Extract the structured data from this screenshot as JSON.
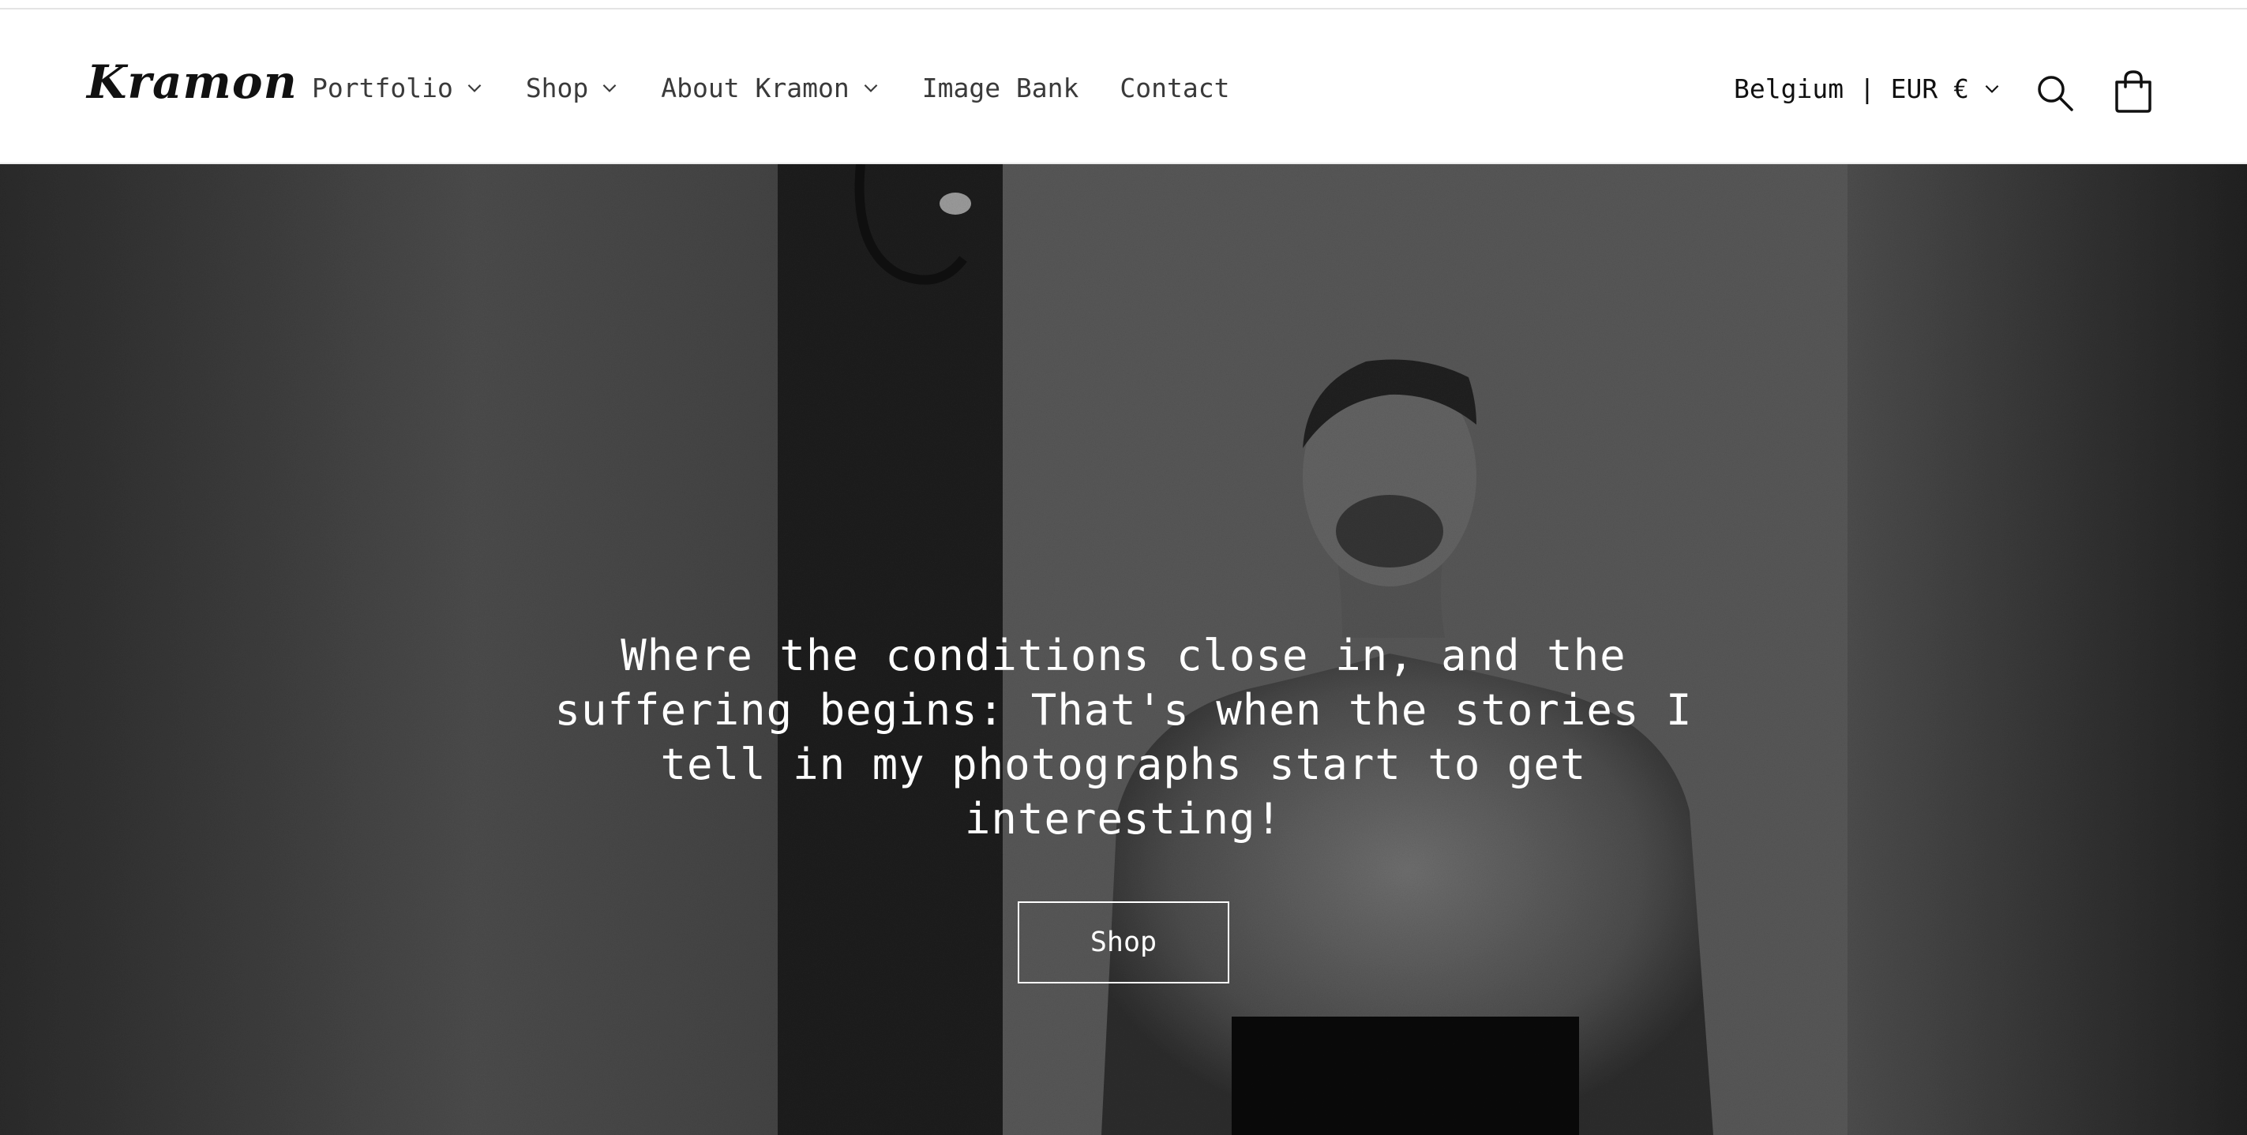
{
  "header": {
    "logo_text": "Kramon",
    "nav": [
      {
        "label": "Portfolio",
        "has_dropdown": true
      },
      {
        "label": "Shop",
        "has_dropdown": true
      },
      {
        "label": "About Kramon",
        "has_dropdown": true
      },
      {
        "label": "Image Bank",
        "has_dropdown": false
      },
      {
        "label": "Contact",
        "has_dropdown": false
      }
    ],
    "localization": "Belgium | EUR €",
    "icons": {
      "dropdown": "chevron-down-icon",
      "search": "search-icon",
      "cart": "cart-icon"
    }
  },
  "hero": {
    "heading": "Where the conditions close in, and the suffering begins: That's when the stories I tell in my photographs start to get interesting!",
    "button_label": "Shop"
  },
  "colors": {
    "header_bg": "#ffffff",
    "nav_text": "#3a3a3a",
    "hero_text": "#ffffff"
  }
}
